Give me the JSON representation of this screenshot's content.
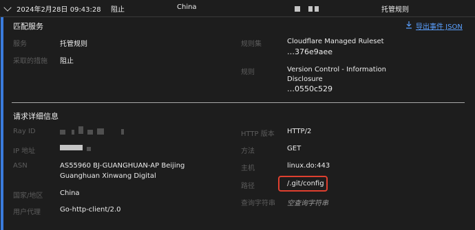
{
  "header": {
    "timestamp": "2024年2月28日 09:43:28",
    "action": "阻止",
    "country": "China",
    "service": "托管规则"
  },
  "match_service": {
    "title": "匹配服务",
    "export_label": "导出事件 JSON",
    "service_label": "服务",
    "service_value": "托管规则",
    "action_label": "采取的措施",
    "action_value": "阻止",
    "ruleset_label": "规则集",
    "ruleset_name": "Cloudflare Managed Ruleset",
    "ruleset_id": "…376e9aee",
    "rule_label": "规则",
    "rule_name_line1": "Version Control - Information",
    "rule_name_line2": "Disclosure",
    "rule_id": "…0550c529"
  },
  "request": {
    "title": "请求详细信息",
    "rayid_label": "Ray ID",
    "ip_label": "IP 地址",
    "asn_label": "ASN",
    "asn_line1": "AS55960 BJ-GUANGHUAN-AP Beijing",
    "asn_line2": "Guanghuan Xinwang Digital",
    "country_label": "国家/地区",
    "country_value": "China",
    "ua_label": "用户代理",
    "ua_value": "Go-http-client/2.0",
    "http_label": "HTTP 版本",
    "http_value": "HTTP/2",
    "method_label": "方法",
    "method_value": "GET",
    "host_label": "主机",
    "host_value": "linux.do:443",
    "path_label": "路径",
    "path_value": "/.git/config",
    "query_label": "查询字符串",
    "query_value": "空查询字符串"
  },
  "colors": {
    "accent": "#3a7bdd",
    "link": "#5aa0ff",
    "highlight": "#e0402f",
    "background": "#1d1d1d"
  },
  "icons": [
    "chevron-down-icon",
    "download-icon"
  ]
}
